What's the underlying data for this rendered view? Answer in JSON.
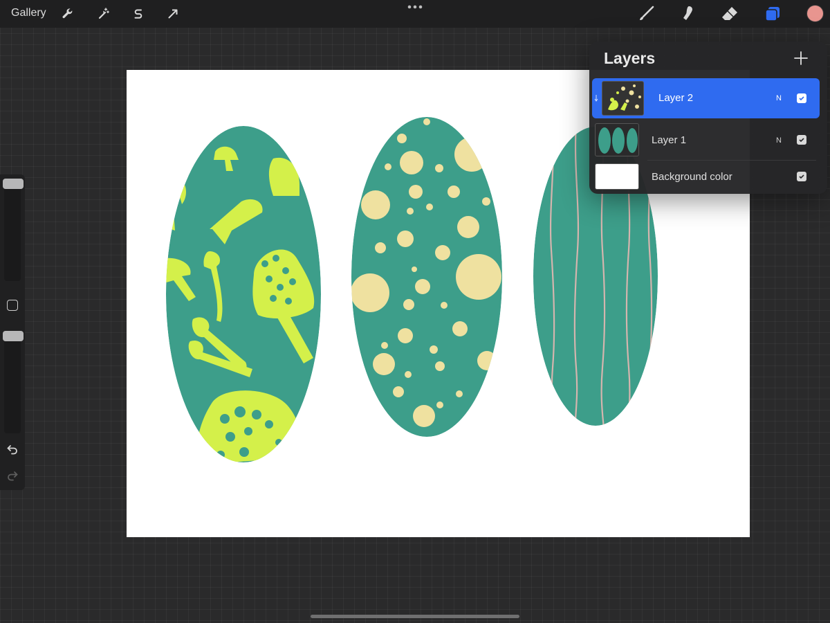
{
  "topbar": {
    "gallery_label": "Gallery",
    "left_tools": [
      "wrench-icon",
      "magic-wand-icon",
      "selection-s-icon",
      "transform-arrow-icon"
    ],
    "right_tools": [
      "brush-icon",
      "smudge-icon",
      "eraser-icon",
      "layers-icon"
    ],
    "active_color": "#e8958f",
    "layers_accent": "#2f6bf0"
  },
  "layers_panel": {
    "title": "Layers",
    "layers": [
      {
        "name": "Layer 2",
        "blend": "N",
        "visible": true,
        "selected": true
      },
      {
        "name": "Layer 1",
        "blend": "N",
        "visible": true,
        "selected": false
      },
      {
        "name": "Background color",
        "blend": "",
        "visible": true,
        "selected": false
      }
    ]
  },
  "canvas_colors": {
    "teal": "#3d9e8a",
    "lime": "#d4f04a",
    "cream": "#efe1a0",
    "stripe": "#e6b7b2",
    "background": "#ffffff"
  }
}
